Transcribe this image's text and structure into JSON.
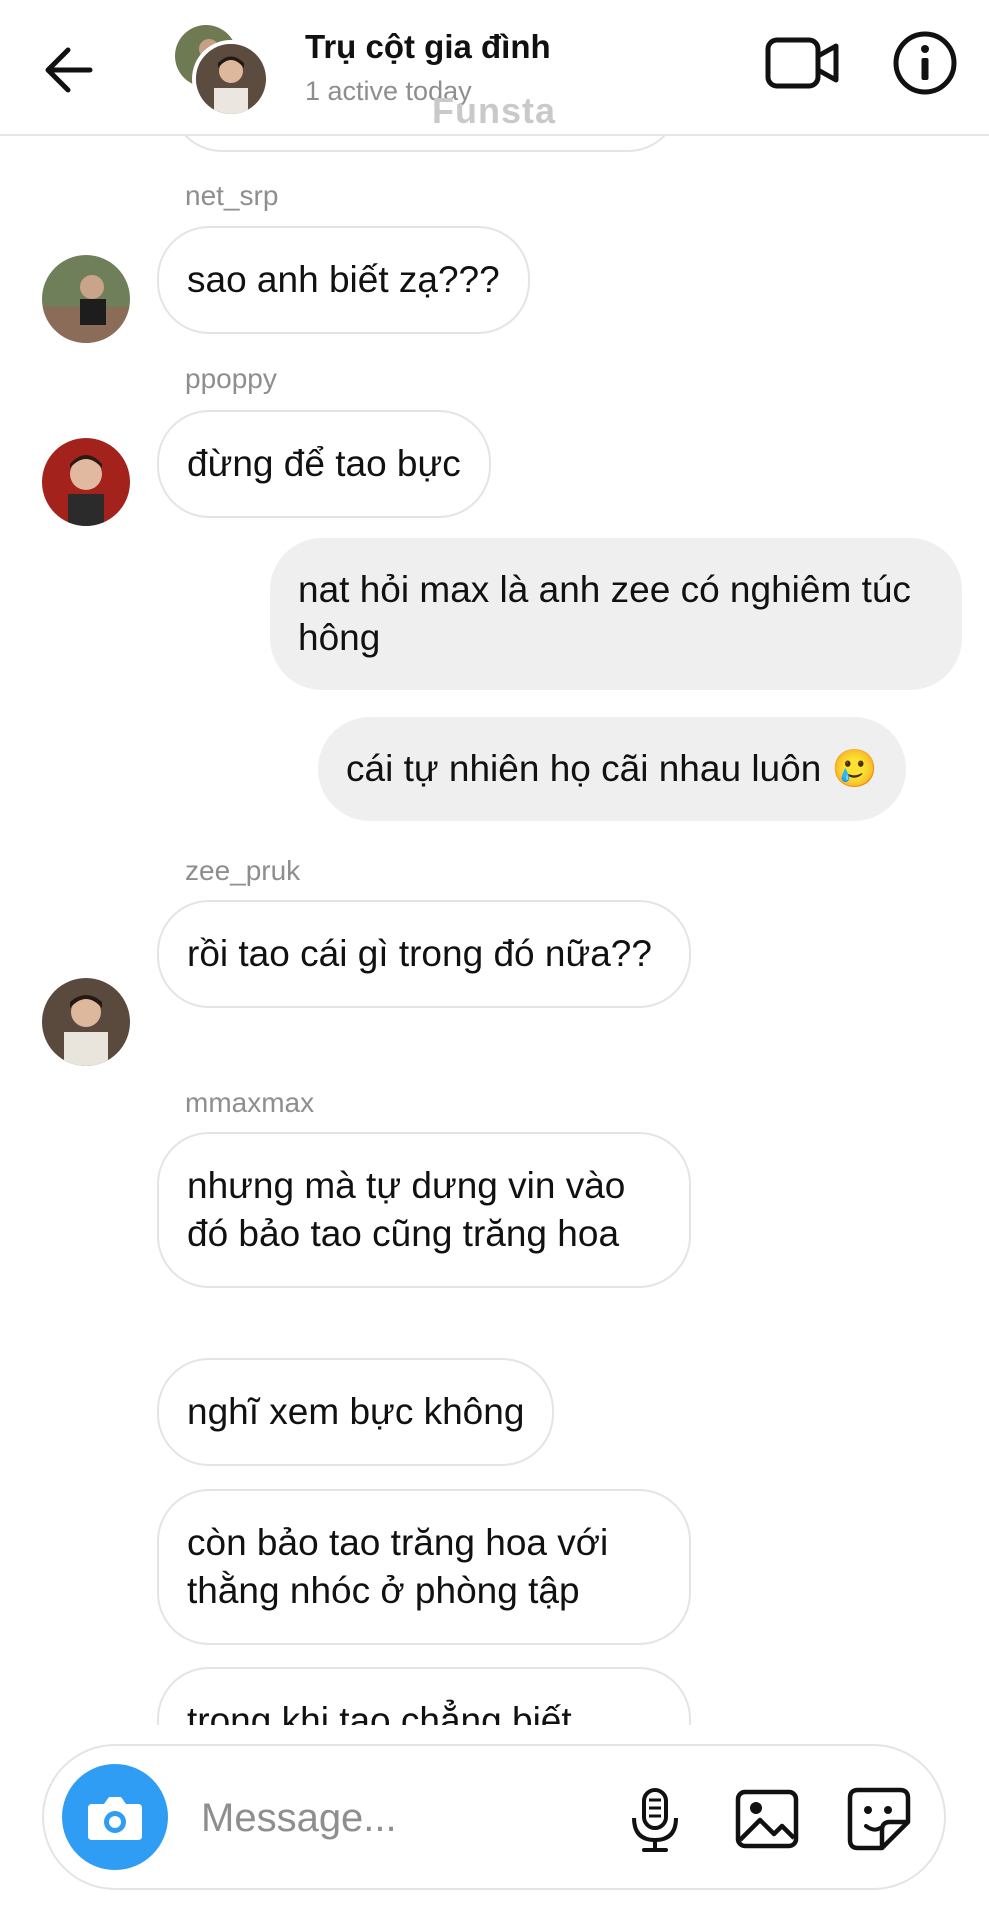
{
  "header": {
    "title": "Trụ cột gia đình",
    "subtitle": "1 active today",
    "watermark": "Funsta"
  },
  "messages": [
    {
      "sender": "net_srp",
      "text": "sao anh biết zạ???",
      "direction": "received"
    },
    {
      "sender": "ppoppy",
      "text": "đừng để tao bực",
      "direction": "received"
    },
    {
      "sender": "me",
      "text": "nat hỏi max là anh zee có nghiêm túc hông",
      "direction": "sent"
    },
    {
      "sender": "me",
      "text": "cái tự nhiên họ cãi nhau luôn 🥲",
      "direction": "sent"
    },
    {
      "sender": "zee_pruk",
      "text": "rồi tao cái gì trong đó nữa??",
      "direction": "received"
    },
    {
      "sender": "mmaxmax",
      "text": "nhưng mà tự dưng vin vào đó bảo tao cũng trăng hoa",
      "direction": "received"
    },
    {
      "sender": "mmaxmax",
      "text": "nghĩ xem bực không",
      "direction": "received"
    },
    {
      "sender": "mmaxmax",
      "text": "còn bảo tao trăng hoa với thằng nhóc ở phòng tập",
      "direction": "received"
    },
    {
      "sender": "mmaxmax",
      "text": "trong khi tao chẳng biết",
      "direction": "received"
    }
  ],
  "composer": {
    "placeholder": "Message...",
    "icons": [
      "camera-icon",
      "microphone-icon",
      "gallery-icon",
      "sticker-icon"
    ]
  },
  "colors": {
    "accent": "#2f9df4",
    "sent_bubble": "#efefef",
    "muted_text": "#8e8e8e"
  }
}
